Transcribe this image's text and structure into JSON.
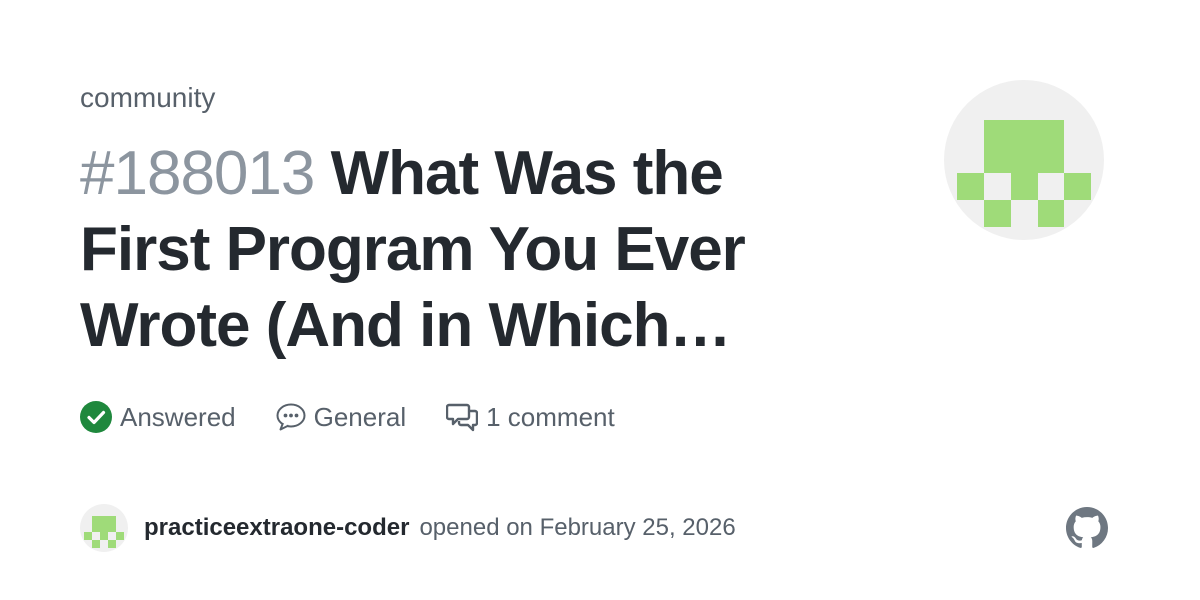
{
  "repo": "community",
  "issue": {
    "number": "#188013",
    "title": "What Was the First Program You Ever Wrote (And in Which…"
  },
  "meta": {
    "status": "Answered",
    "category": "General",
    "comments": "1 comment"
  },
  "byline": {
    "author": "practiceextraone-coder",
    "opened_text": "opened on February 25, 2026"
  },
  "icons": {
    "status": "check-circle-icon",
    "category": "speech-balloon-icon",
    "comments": "comment-discussion-icon",
    "brand": "github-mark-icon"
  },
  "colors": {
    "answered_green": "#1f883d",
    "avatar_green": "#9fdb79",
    "avatar_bg": "#f0f0f0",
    "title": "#24292f",
    "muted": "#57606a",
    "number": "#8c959f",
    "github_logo": "#6e7781"
  }
}
